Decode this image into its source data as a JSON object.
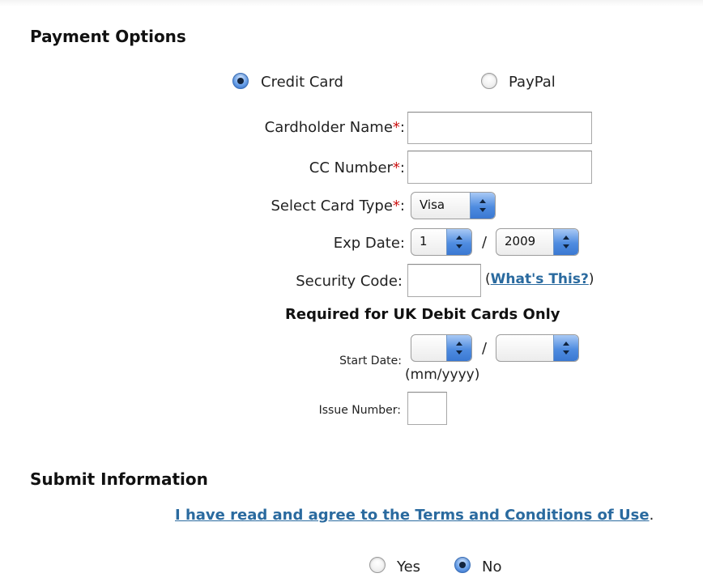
{
  "payment": {
    "title": "Payment Options",
    "method": {
      "options": [
        {
          "label": "Credit Card",
          "checked": true
        },
        {
          "label": "PayPal",
          "checked": false
        }
      ]
    },
    "cardholder": {
      "label": "Cardholder Name",
      "required_mark": "*",
      "colon": ":",
      "value": ""
    },
    "cc_number": {
      "label": "CC Number",
      "required_mark": "*",
      "colon": ":",
      "value": ""
    },
    "card_type": {
      "label": "Select Card Type",
      "required_mark": "*",
      "colon": ":",
      "selected": "Visa"
    },
    "exp_date": {
      "label": "Exp Date:",
      "month": "1",
      "separator": "/",
      "year": "2009"
    },
    "security_code": {
      "label": "Security Code:",
      "value": "",
      "help_open": "(",
      "help_link": "What's This?",
      "help_close": ")"
    },
    "uk_debit": {
      "heading": "Required for UK Debit Cards Only",
      "start_date_label": "Start Date:",
      "start_month": "",
      "separator": "/",
      "start_year": "",
      "format_hint": "(mm/yyyy)",
      "issue_number_label": "Issue Number:",
      "issue_number_value": ""
    }
  },
  "submit": {
    "title": "Submit Information",
    "terms_link": "I have read and agree to the Terms and Conditions of Use",
    "terms_period": ".",
    "agree": {
      "options": [
        {
          "label": "Yes",
          "checked": false
        },
        {
          "label": "No",
          "checked": true
        }
      ]
    }
  },
  "colors": {
    "required": "#cc1111",
    "link": "#2a6a9f",
    "select_accent": "#4f8ce0"
  }
}
